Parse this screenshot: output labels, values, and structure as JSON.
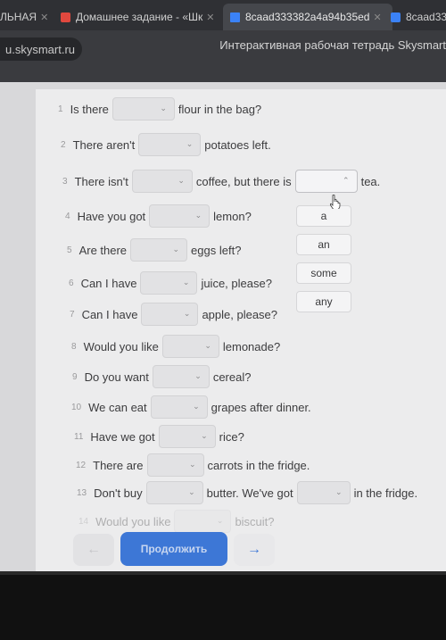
{
  "tabs": [
    {
      "title": "ЛЬНАЯ",
      "icon": "page-icon",
      "color": "#8a8a8a"
    },
    {
      "title": "Домашнее задание - «Шк",
      "icon": "school-icon",
      "color": "#e0483e"
    },
    {
      "title": "8caad333382a4a94b35ed",
      "icon": "document-icon",
      "color": "#3b82f6"
    },
    {
      "title": "8caad333",
      "icon": "document-icon",
      "color": "#3b82f6"
    }
  ],
  "address": "u.skysmart.ru",
  "page_title": "Интерактивная рабочая тетрадь Skysmart",
  "exercise": {
    "rows": [
      {
        "n": "1",
        "before": "Is there",
        "after": "flour in the bag?"
      },
      {
        "n": "2",
        "before": "There aren't",
        "after": "potatoes left."
      },
      {
        "n": "3",
        "before": "There isn't",
        "mid": "coffee, but there is",
        "after": "tea."
      },
      {
        "n": "4",
        "before": "Have you got",
        "after": "lemon?"
      },
      {
        "n": "5",
        "before": "Are there",
        "after": "eggs left?"
      },
      {
        "n": "6",
        "before": "Can I have",
        "after": "juice, please?"
      },
      {
        "n": "7",
        "before": "Can I have",
        "after": "apple, please?"
      },
      {
        "n": "8",
        "before": "Would you like",
        "after": "lemonade?"
      },
      {
        "n": "9",
        "before": "Do you want",
        "after": "cereal?"
      },
      {
        "n": "10",
        "before": "We can eat",
        "after": "grapes after dinner."
      },
      {
        "n": "11",
        "before": "Have we got",
        "after": "rice?"
      },
      {
        "n": "12",
        "before": "There are",
        "after": "carrots in the fridge."
      },
      {
        "n": "13",
        "before": "Don't buy",
        "mid": "butter. We've got",
        "after": "in the fridge."
      },
      {
        "n": "14",
        "before": "Would you like",
        "after": "biscuit?"
      }
    ],
    "options": [
      "a",
      "an",
      "some",
      "any"
    ]
  },
  "footer": {
    "prev": "←",
    "continue": "Продолжить",
    "next": "→"
  }
}
